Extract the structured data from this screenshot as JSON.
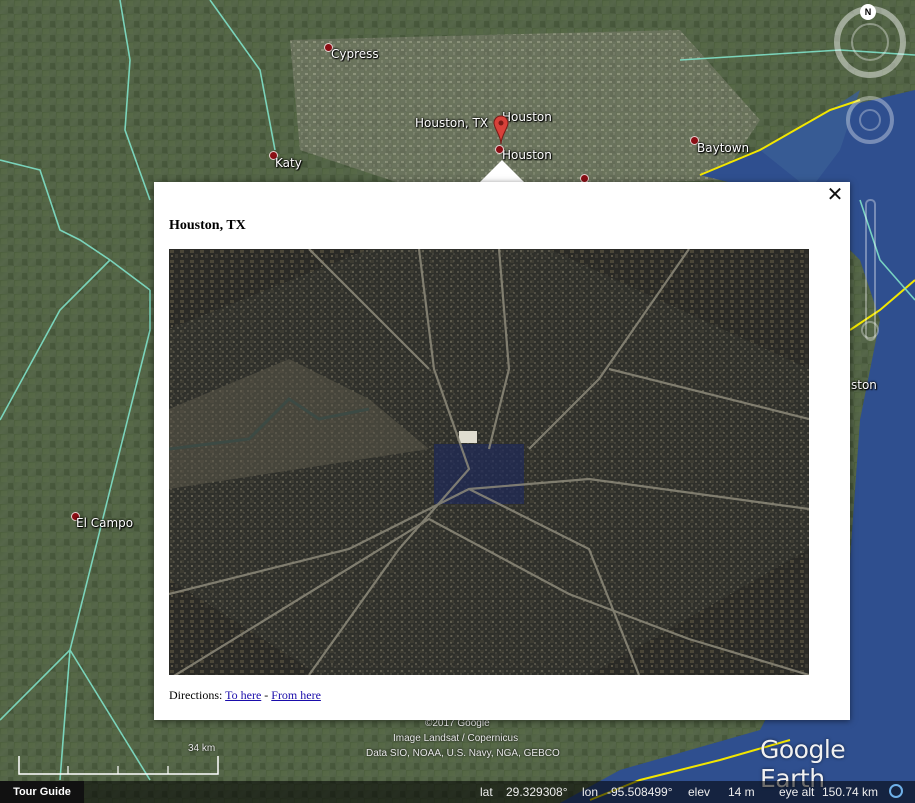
{
  "map": {
    "places": [
      {
        "name": "Cypress"
      },
      {
        "name": "Katy"
      },
      {
        "name": "Houston, TX"
      },
      {
        "name": "Houston"
      },
      {
        "name": "Houston"
      },
      {
        "name": "Baytown"
      },
      {
        "name": "El Campo"
      }
    ],
    "partial_label": "ston",
    "scale_label": "34 km",
    "attribution": [
      "©2017 Google",
      "Image Landsat / Copernicus",
      "Data SIO, NOAA, U.S. Navy, NGA, GEBCO"
    ],
    "logo": "Google Earth",
    "compass": "N"
  },
  "popup": {
    "title": "Houston, TX",
    "close_glyph": "✕",
    "directions_label": "Directions:",
    "to_here": "To here",
    "separator": " - ",
    "from_here": "From here"
  },
  "statusbar": {
    "tour_guide": "Tour Guide",
    "lat_label": "lat",
    "lat_value": "29.329308°",
    "lon_label": "lon",
    "lon_value": "-95.508499°",
    "elev_label": "elev",
    "elev_value": "14 m",
    "eye_alt_label": "eye alt",
    "eye_alt_value": "150.74 km"
  },
  "colors": {
    "boundary": "#7fe0c8",
    "coastline": "#f2e600",
    "water": "#2f4f8f",
    "pin": "#c9302c"
  }
}
